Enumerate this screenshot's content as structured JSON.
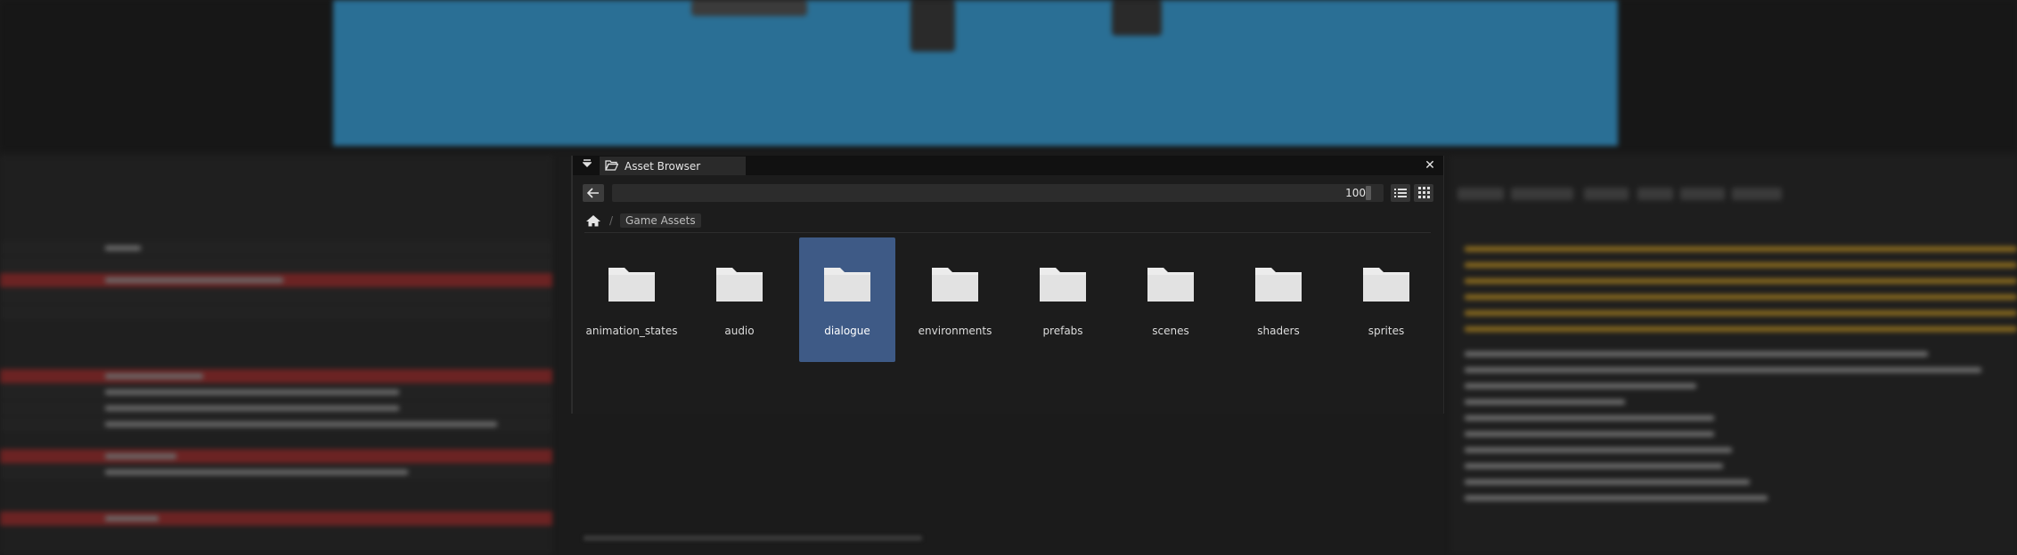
{
  "window": {
    "title": "Asset Browser"
  },
  "toolbar": {
    "path_value": "",
    "zoom_value": "100"
  },
  "breadcrumb": {
    "items": [
      "Game Assets"
    ]
  },
  "folders": [
    {
      "name": "animation_states",
      "selected": false
    },
    {
      "name": "audio",
      "selected": false
    },
    {
      "name": "dialogue",
      "selected": true
    },
    {
      "name": "environments",
      "selected": false
    },
    {
      "name": "prefabs",
      "selected": false
    },
    {
      "name": "scenes",
      "selected": false
    },
    {
      "name": "shaders",
      "selected": false
    },
    {
      "name": "sprites",
      "selected": false
    }
  ],
  "colors": {
    "selection": "#3e5a86",
    "panel_bg": "#1c1c1c",
    "viewport": "#2a6f95",
    "error_row": "#6b2323",
    "warning_text": "#8a6a1e"
  },
  "icons": [
    "chevron-down-icon",
    "folder-open-icon",
    "close-icon",
    "arrow-left-icon",
    "list-view-icon",
    "grid-view-icon",
    "home-icon",
    "folder-icon"
  ]
}
